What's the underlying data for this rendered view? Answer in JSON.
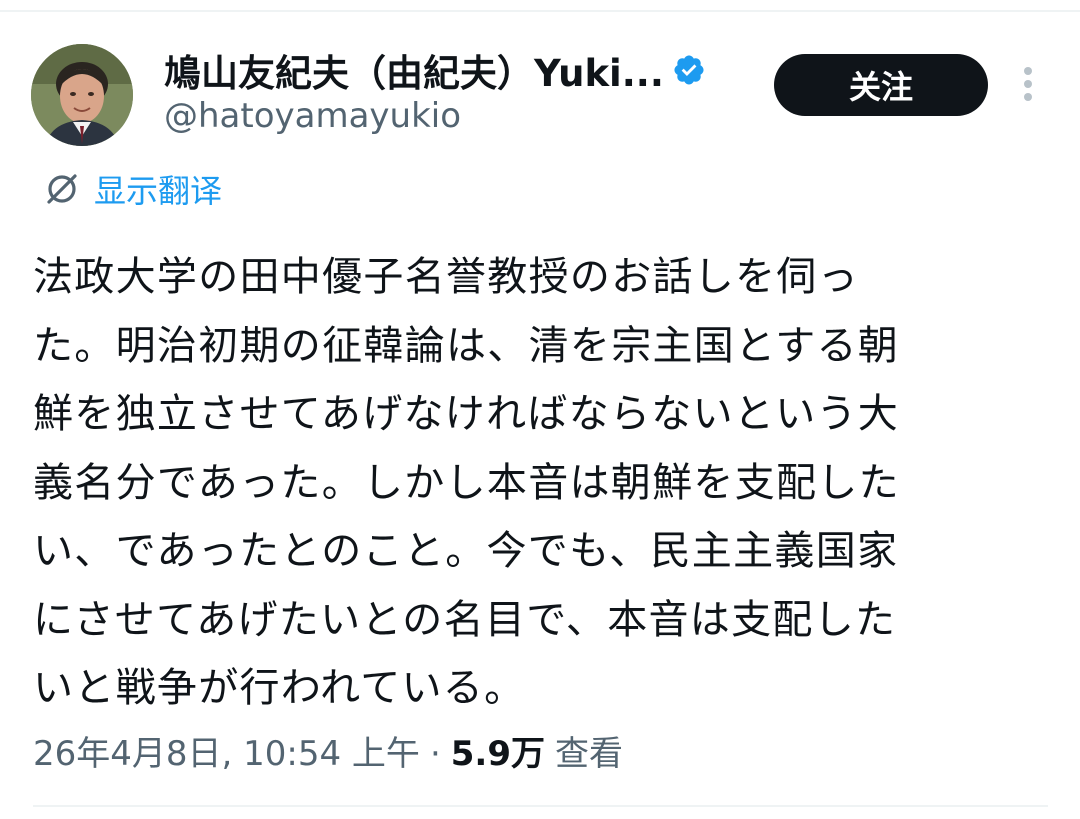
{
  "author": {
    "display_name": "鳩山友紀夫（由紀夫）Yuki...",
    "handle": "@hatoyamayukio",
    "verified": true,
    "verified_color": "#1d9bf0"
  },
  "actions": {
    "follow_label": "关注"
  },
  "translate": {
    "label": "显示翻译",
    "color": "#1d9bf0"
  },
  "tweet": {
    "lines": [
      "法政大学の田中優子名誉教授のお話しを伺っ",
      "た。明治初期の征韓論は、清を宗主国とする朝",
      "鮮を独立させてあげなければならないという大",
      "義名分であった。しかし本音は朝鮮を支配した",
      "い、であったとのこと。今でも、民主主義国家",
      "にさせてあげたいとの名目で、本音は支配した",
      "いと戦争が行われている。"
    ]
  },
  "meta": {
    "timestamp": "26年4月8日, 10:54 上午",
    "separator": "·",
    "view_count": "5.9万",
    "views_label": "查看"
  },
  "icons": {
    "avatar": "user-avatar",
    "verified": "verified-badge-icon",
    "more": "more-vertical-icon",
    "translate": "translate-icon"
  }
}
